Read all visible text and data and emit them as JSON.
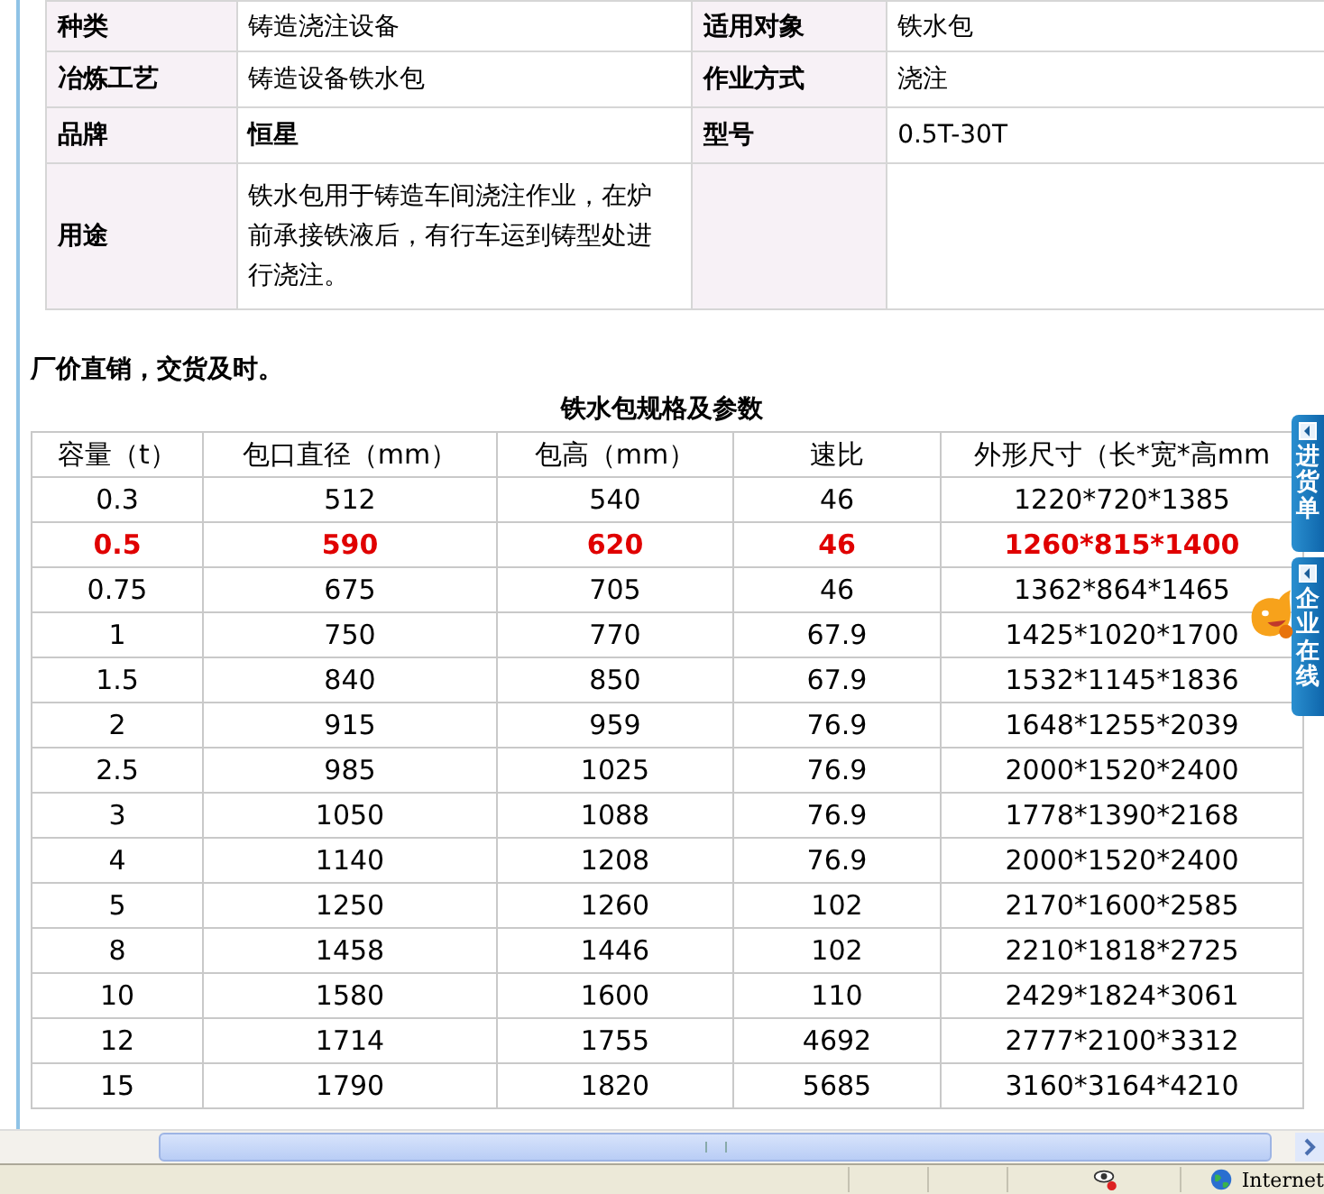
{
  "attributes": [
    {
      "pairs": [
        {
          "label": "种类",
          "value": "铸造浇注设备",
          "value_bold": false
        },
        {
          "label": "适用对象",
          "value": "铁水包",
          "value_bold": false
        }
      ]
    },
    {
      "pairs": [
        {
          "label": "冶炼工艺",
          "value": "铸造设备铁水包",
          "value_bold": false
        },
        {
          "label": "作业方式",
          "value": "浇注",
          "value_bold": false
        }
      ]
    },
    {
      "pairs": [
        {
          "label": "品牌",
          "value": "恒星",
          "value_bold": true
        },
        {
          "label": "型号",
          "value": "0.5T-30T",
          "value_bold": false
        }
      ]
    },
    {
      "pairs": [
        {
          "label": "用途",
          "value": "铁水包用于铸造车间浇注作业，在炉前承接铁液后，有行车运到铸型处进行浇注。",
          "value_bold": false
        }
      ]
    }
  ],
  "slogan": "厂价直销，交货及时。",
  "spec_table": {
    "title": "铁水包规格及参数",
    "columns": [
      "容量（t）",
      "包口直径（mm）",
      "包高（mm）",
      "速比",
      "外形尺寸（长*宽*高mm"
    ],
    "rows": [
      {
        "highlighted": false,
        "cells": [
          "0.3",
          "512",
          "540",
          "46",
          "1220*720*1385"
        ]
      },
      {
        "highlighted": true,
        "cells": [
          "0.5",
          "590",
          "620",
          "46",
          "1260*815*1400"
        ]
      },
      {
        "highlighted": false,
        "cells": [
          "0.75",
          "675",
          "705",
          "46",
          "1362*864*1465"
        ]
      },
      {
        "highlighted": false,
        "cells": [
          "1",
          "750",
          "770",
          "67.9",
          "1425*1020*1700"
        ]
      },
      {
        "highlighted": false,
        "cells": [
          "1.5",
          "840",
          "850",
          "67.9",
          "1532*1145*1836"
        ]
      },
      {
        "highlighted": false,
        "cells": [
          "2",
          "915",
          "959",
          "76.9",
          "1648*1255*2039"
        ]
      },
      {
        "highlighted": false,
        "cells": [
          "2.5",
          "985",
          "1025",
          "76.9",
          "2000*1520*2400"
        ]
      },
      {
        "highlighted": false,
        "cells": [
          "3",
          "1050",
          "1088",
          "76.9",
          "1778*1390*2168"
        ]
      },
      {
        "highlighted": false,
        "cells": [
          "4",
          "1140",
          "1208",
          "76.9",
          "2000*1520*2400"
        ]
      },
      {
        "highlighted": false,
        "cells": [
          "5",
          "1250",
          "1260",
          "102",
          "2170*1600*2585"
        ]
      },
      {
        "highlighted": false,
        "cells": [
          "8",
          "1458",
          "1446",
          "102",
          "2210*1818*2725"
        ]
      },
      {
        "highlighted": false,
        "cells": [
          "10",
          "1580",
          "1600",
          "110",
          "2429*1824*3061"
        ]
      },
      {
        "highlighted": false,
        "cells": [
          "12",
          "1714",
          "1755",
          "4692",
          "2777*2100*3312"
        ]
      },
      {
        "highlighted": false,
        "cells": [
          "15",
          "1790",
          "1820",
          "5685",
          "3160*3164*4210"
        ]
      }
    ]
  },
  "side_tabs": [
    {
      "label": "进货单"
    },
    {
      "label": "企业在线"
    }
  ],
  "status_bar": {
    "zone": "Internet"
  }
}
